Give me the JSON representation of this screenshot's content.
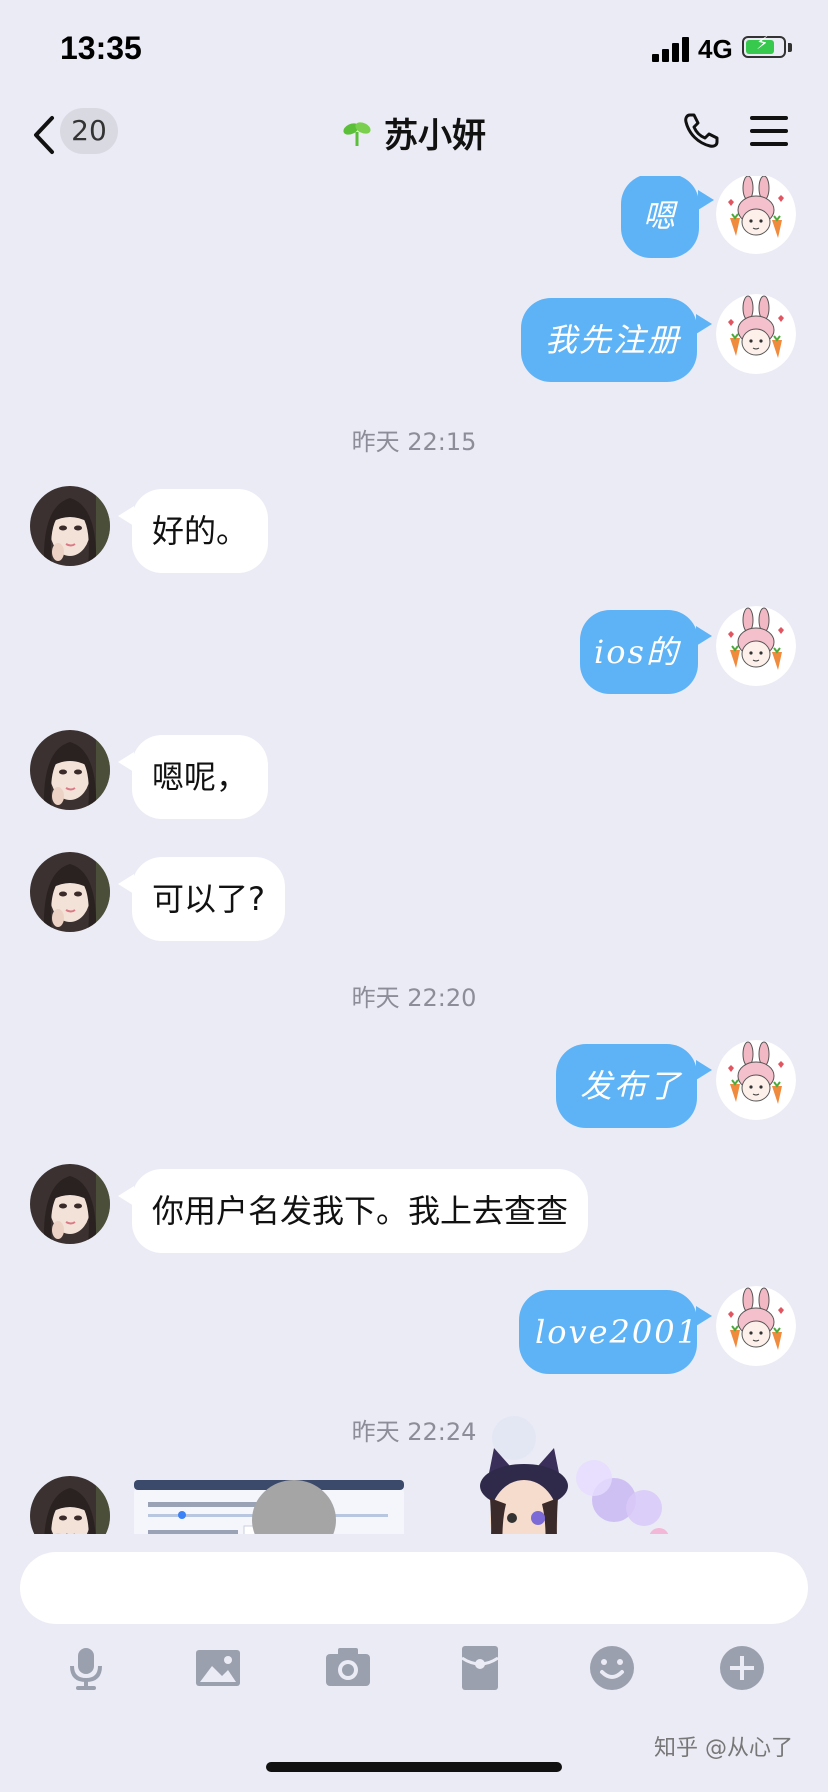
{
  "status": {
    "time": "13:35",
    "network": "4G"
  },
  "nav": {
    "back_count": "20",
    "title": "苏小妍"
  },
  "colors": {
    "out_bubble": "#5eb3f7",
    "in_bubble": "#ffffff",
    "background": "#ebebf5"
  },
  "chat": {
    "messages": [
      {
        "from": "me",
        "text": "嗯"
      },
      {
        "from": "me",
        "text": "我先注册"
      },
      {
        "timestamp": "昨天 22:15"
      },
      {
        "from": "contact",
        "text": "好的。"
      },
      {
        "from": "me",
        "text": "ios的"
      },
      {
        "from": "contact",
        "text": "嗯呢，"
      },
      {
        "from": "contact",
        "text": "可以了?"
      },
      {
        "timestamp": "昨天 22:20"
      },
      {
        "from": "me",
        "text": "发布了"
      },
      {
        "from": "contact",
        "text": "你用户名发我下。我上去查查"
      },
      {
        "from": "me",
        "text": "love2001"
      },
      {
        "timestamp": "昨天 22:24"
      },
      {
        "from": "contact",
        "type": "image"
      },
      {
        "from": "contact",
        "type": "sticker"
      }
    ]
  },
  "input": {
    "value": "",
    "placeholder": ""
  },
  "toolbar": [
    "microphone-icon",
    "image-icon",
    "camera-icon",
    "red-packet-icon",
    "emoji-icon",
    "plus-icon"
  ],
  "watermark": "知乎 @从心了"
}
